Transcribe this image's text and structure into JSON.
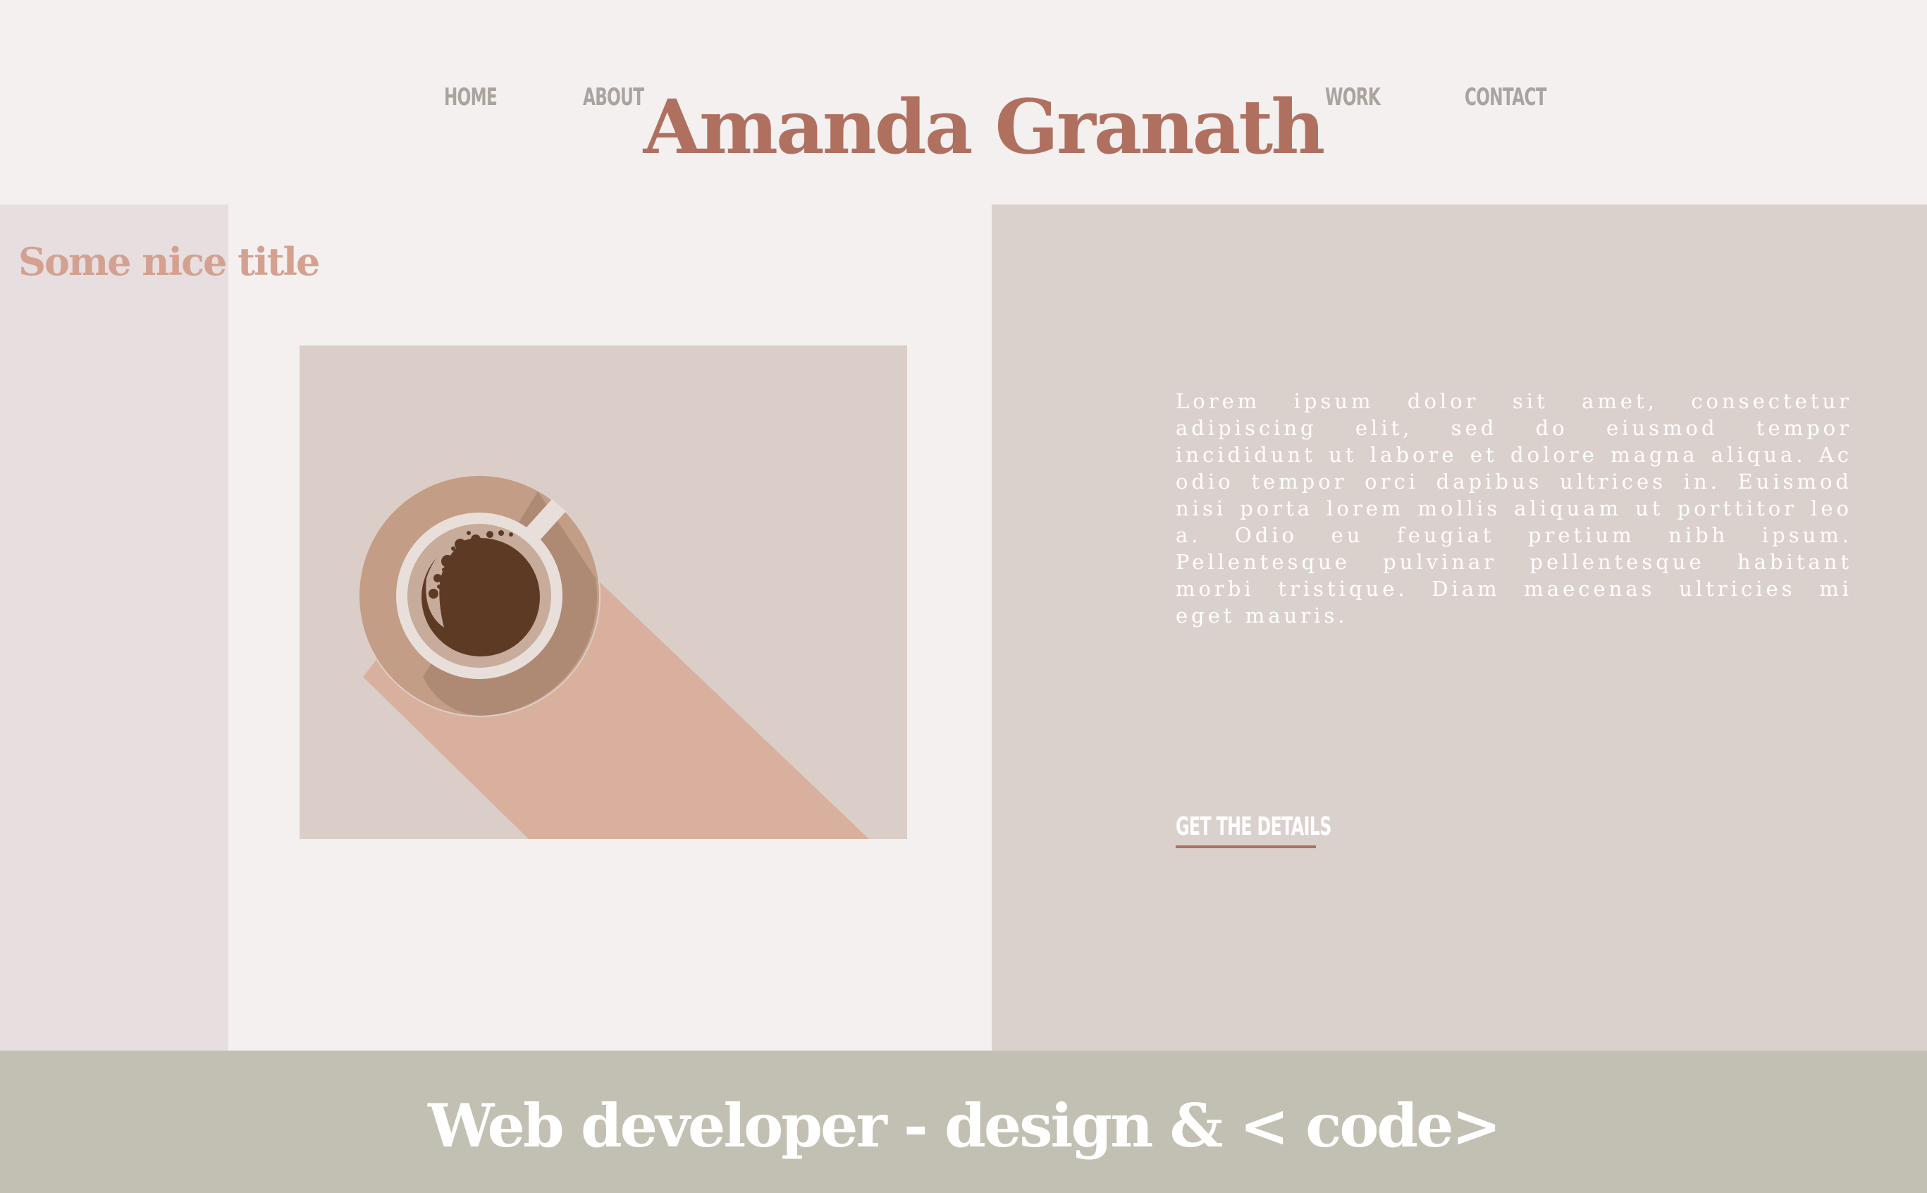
{
  "nav": {
    "home": "HOME",
    "about": "ABOUT",
    "work": "WORK",
    "contact": "CONTACT"
  },
  "site_title": "Amanda Granath",
  "section": {
    "title": "Some nice title",
    "image_subject": "coffee-cup-icon",
    "description": "Lorem ipsum dolor sit amet, consectetur adipiscing elit, sed do eiusmod tempor incididunt ut labore et dolore magna aliqua. Ac odio tempor orci dapibus ultrices in. Euismod nisi porta lorem mollis aliquam ut porttitor leo a. Odio eu feugiat pretium nibh ipsum. Pellentesque pulvinar pellentesque habitant morbi tristique. Diam maecenas ultricies mi eget mauris.",
    "cta": "GET THE DETAILS"
  },
  "footer": {
    "tagline": "Web developer - design & < code>"
  },
  "colors": {
    "background": "#f4f0ef",
    "accent": "#b07060",
    "nav_text": "#aaa39f",
    "section_title": "#d4a191",
    "left_strip": "#e7dee0",
    "right_panel": "#dbd1cc",
    "footer": "#c2c0b3"
  }
}
